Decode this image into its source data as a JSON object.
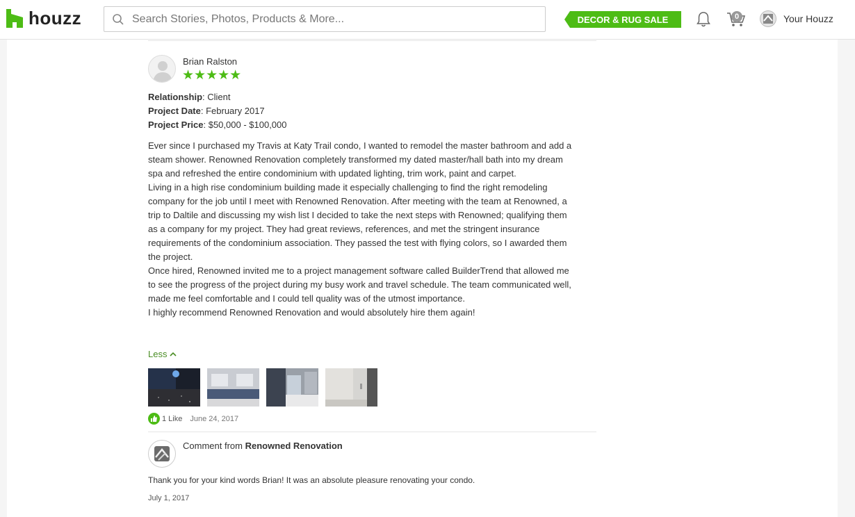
{
  "header": {
    "logo_text": "houzz",
    "search_placeholder": "Search Stories, Photos, Products & More...",
    "sale_label": "DECOR & RUG SALE",
    "cart_count": "0",
    "account_label": "Your Houzz",
    "brand_color": "#4dbc15"
  },
  "review": {
    "reviewer_name": "Brian Ralston",
    "rating": 5,
    "stars": "★★★★★",
    "relationship_label": "Relationship",
    "relationship_value": ": Client",
    "project_date_label": "Project Date",
    "project_date_value": ": February 2017",
    "project_price_label": "Project Price",
    "project_price_value": ": $50,000 - $100,000",
    "paragraphs": [
      "Ever since I purchased my Travis at Katy Trail condo, I wanted to remodel the master bathroom and add a steam shower. Renowned Renovation completely transformed my dated master/hall bath into my dream spa and refreshed the entire condominium with updated lighting, trim work, paint and carpet.",
      "Living in a high rise condominium building made it especially challenging to find the right remodeling company for the job until I meet with Renowned Renovation. After meeting with the team at Renowned, a trip to Daltile and discussing my wish list I decided to take the next steps with Renowned; qualifying them as a company for my project. They had great reviews, references, and met the stringent insurance requirements of the condominium association. They passed the test with flying colors, so I awarded them the project.",
      "Once hired, Renowned invited me to a project management software called BuilderTrend that allowed me to see the progress of the project during my busy work and travel schedule. The team communicated well, made me feel comfortable and I could tell quality was of the utmost importance.",
      "I highly recommend Renowned Renovation and would absolutely hire them again!"
    ],
    "less_label": "Less",
    "like_count": "1 Like",
    "date": "June 24, 2017"
  },
  "comment": {
    "prefix": "Comment from ",
    "author": "Renowned Renovation",
    "text": "Thank you for your kind words Brian! It was an absolute pleasure renovating your condo.",
    "date": "July 1, 2017"
  }
}
